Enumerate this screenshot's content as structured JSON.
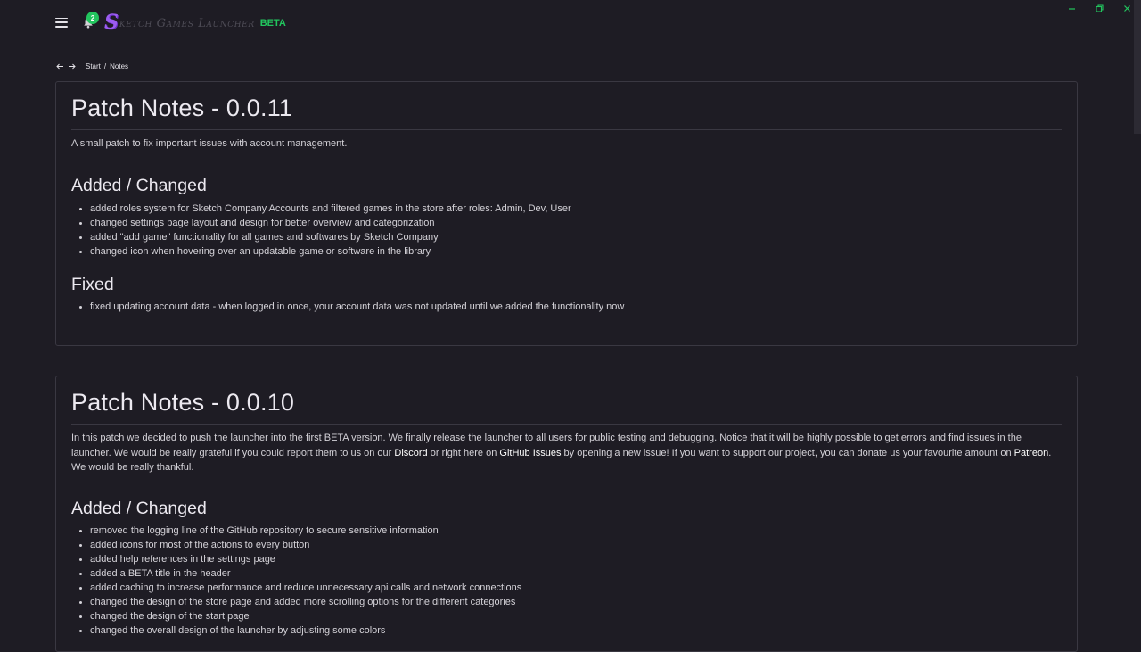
{
  "window": {
    "minimize_icon": "minimize-icon",
    "maximize_icon": "restore-icon",
    "close_icon": "close-icon",
    "accent_color": "#22c55e"
  },
  "header": {
    "menu_icon": "hamburger-menu-icon",
    "bell_icon": "bell-icon",
    "notification_count": "2",
    "logo_initial": "S",
    "logo_text": "ketch Games Launcher",
    "beta_label": "BETA"
  },
  "breadcrumb": {
    "back_icon": "arrow-left-icon",
    "forward_icon": "arrow-right-icon",
    "start": "Start",
    "separator": "/",
    "current": "Notes"
  },
  "notes": [
    {
      "title": "Patch Notes - 0.0.11",
      "intro": "A small patch to fix important issues with account management.",
      "sections": [
        {
          "heading": "Added / Changed",
          "items": [
            "added roles system for Sketch Company Accounts and filtered games in the store after roles: Admin, Dev, User",
            "changed settings page layout and design for better overview and categorization",
            "added \"add game\" functionality for all games and softwares by Sketch Company",
            "changed icon when hovering over an updatable game or software in the library"
          ]
        },
        {
          "heading": "Fixed",
          "items": [
            "fixed updating account data - when logged in once, your account data was not updated until we added the functionality now"
          ]
        }
      ]
    },
    {
      "title": "Patch Notes - 0.0.10",
      "intro_parts": {
        "p1": "In this patch we decided to push the launcher into the first BETA version. We finally release the launcher to all users for public testing and debugging. Notice that it will be highly possible to get errors and find issues in the launcher. We would be really grateful if you could report them to us on our ",
        "discord": "Discord",
        "p2": " or right here on ",
        "github": "GitHub Issues",
        "p3": " by opening a new issue! If you want to support our project, you can donate us your favourite amount on ",
        "patreon": "Patreon",
        "p4": ". We would be really thankful."
      },
      "sections": [
        {
          "heading": "Added / Changed",
          "items": [
            "removed the logging line of the GitHub repository to secure sensitive information",
            "added icons for most of the actions to every button",
            "added help references in the settings page",
            "added a BETA title in the header",
            "added caching to increase performance and reduce unnecessary api calls and network connections",
            "changed the design of the store page and added more scrolling options for the different categories",
            "changed the design of the start page",
            "changed the overall design of the launcher by adjusting some colors"
          ]
        }
      ]
    }
  ]
}
